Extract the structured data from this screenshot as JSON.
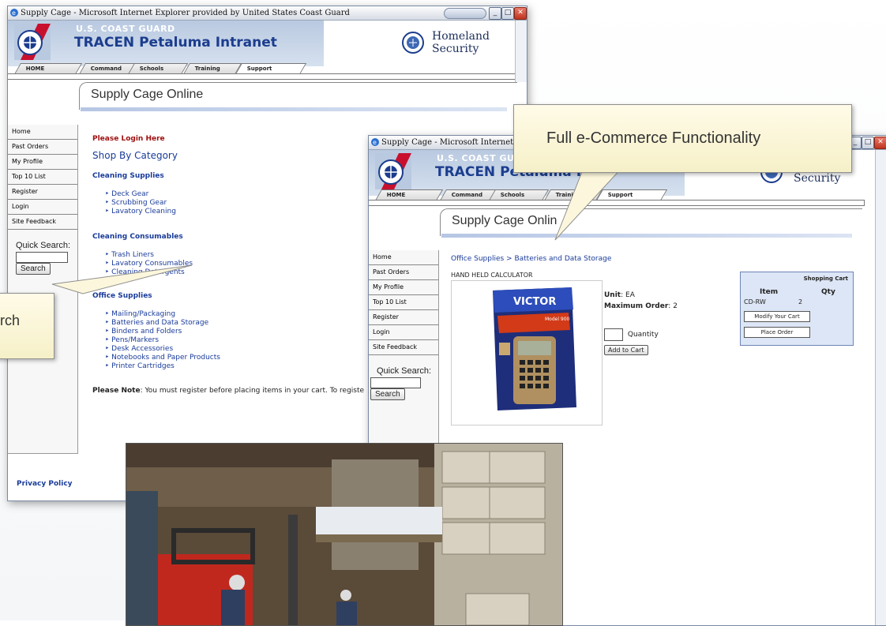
{
  "back_window": {
    "title": "Supply Cage - Microsoft Internet Explorer provided by United States Coast Guard",
    "org": "U.S. COAST GUARD",
    "site": "TRACEN Petaluma Intranet",
    "dhs_line1": "Homeland",
    "dhs_line2": "Security",
    "tabs": [
      "HOME",
      "Command",
      "Schools",
      "Training",
      "Support"
    ],
    "page_title": "Supply Cage Online",
    "nav": [
      "Home",
      "Past Orders",
      "My Profile",
      "Top 10 List",
      "Register",
      "Login",
      "Site Feedback"
    ],
    "quick_search_label": "Quick Search:",
    "search_button": "Search",
    "login_link": "Please Login Here",
    "shop_heading": "Shop By Category",
    "categories": [
      {
        "name": "Cleaning Supplies",
        "items": [
          "Deck Gear",
          "Scrubbing Gear",
          "Lavatory Cleaning"
        ]
      },
      {
        "name": "Cleaning Consumables",
        "items": [
          "Trash Liners",
          "Lavatory Consumables",
          "Cleaning Detergents"
        ]
      },
      {
        "name": "Office Supplies",
        "items": [
          "Mailing/Packaging",
          "Batteries and Data Storage",
          "Binders and Folders",
          "Pens/Markers",
          "Desk Accessories",
          "Notebooks and Paper Products",
          "Printer Cartridges"
        ]
      }
    ],
    "note_label": "Please Note",
    "note_text": ": You must register before placing items in your cart. To registe",
    "privacy": "Privacy Policy"
  },
  "front_window": {
    "title": "Supply Cage - Microsoft Internet Explor",
    "org": "U.S. COAST GUAR",
    "site": "TRACEN Petaluma Intra",
    "dhs_line2": "Security",
    "tabs": [
      "HOME",
      "Command",
      "Schools",
      "Training",
      "Support"
    ],
    "page_title": "Supply Cage Onlin",
    "nav": [
      "Home",
      "Past Orders",
      "My Profile",
      "Top 10 List",
      "Register",
      "Login",
      "Site Feedback"
    ],
    "quick_search_label": "Quick Search:",
    "search_button": "Search",
    "breadcrumb": "Office Supplies > Batteries and Data Storage",
    "product_name": "HAND HELD CALCULATOR",
    "product_brand": "VICTOR",
    "product_model": "Model 900",
    "unit_label": "Unit",
    "unit_value": ": EA",
    "max_label": "Maximum Order",
    "max_value": ": 2",
    "quantity_label": "Quantity",
    "add_to_cart": "Add to Cart",
    "cart": {
      "title": "Shopping Cart",
      "col_item": "Item",
      "col_qty": "Qty",
      "item": "CD-RW",
      "qty": "2",
      "modify": "Modify Your Cart",
      "place": "Place Order"
    }
  },
  "callouts": {
    "ecommerce": "Full e-Commerce Functionality",
    "search": "rch"
  },
  "colors": {
    "link": "#1a3c9a",
    "login_red": "#a01010",
    "callout_bg": "#fffbe8"
  }
}
